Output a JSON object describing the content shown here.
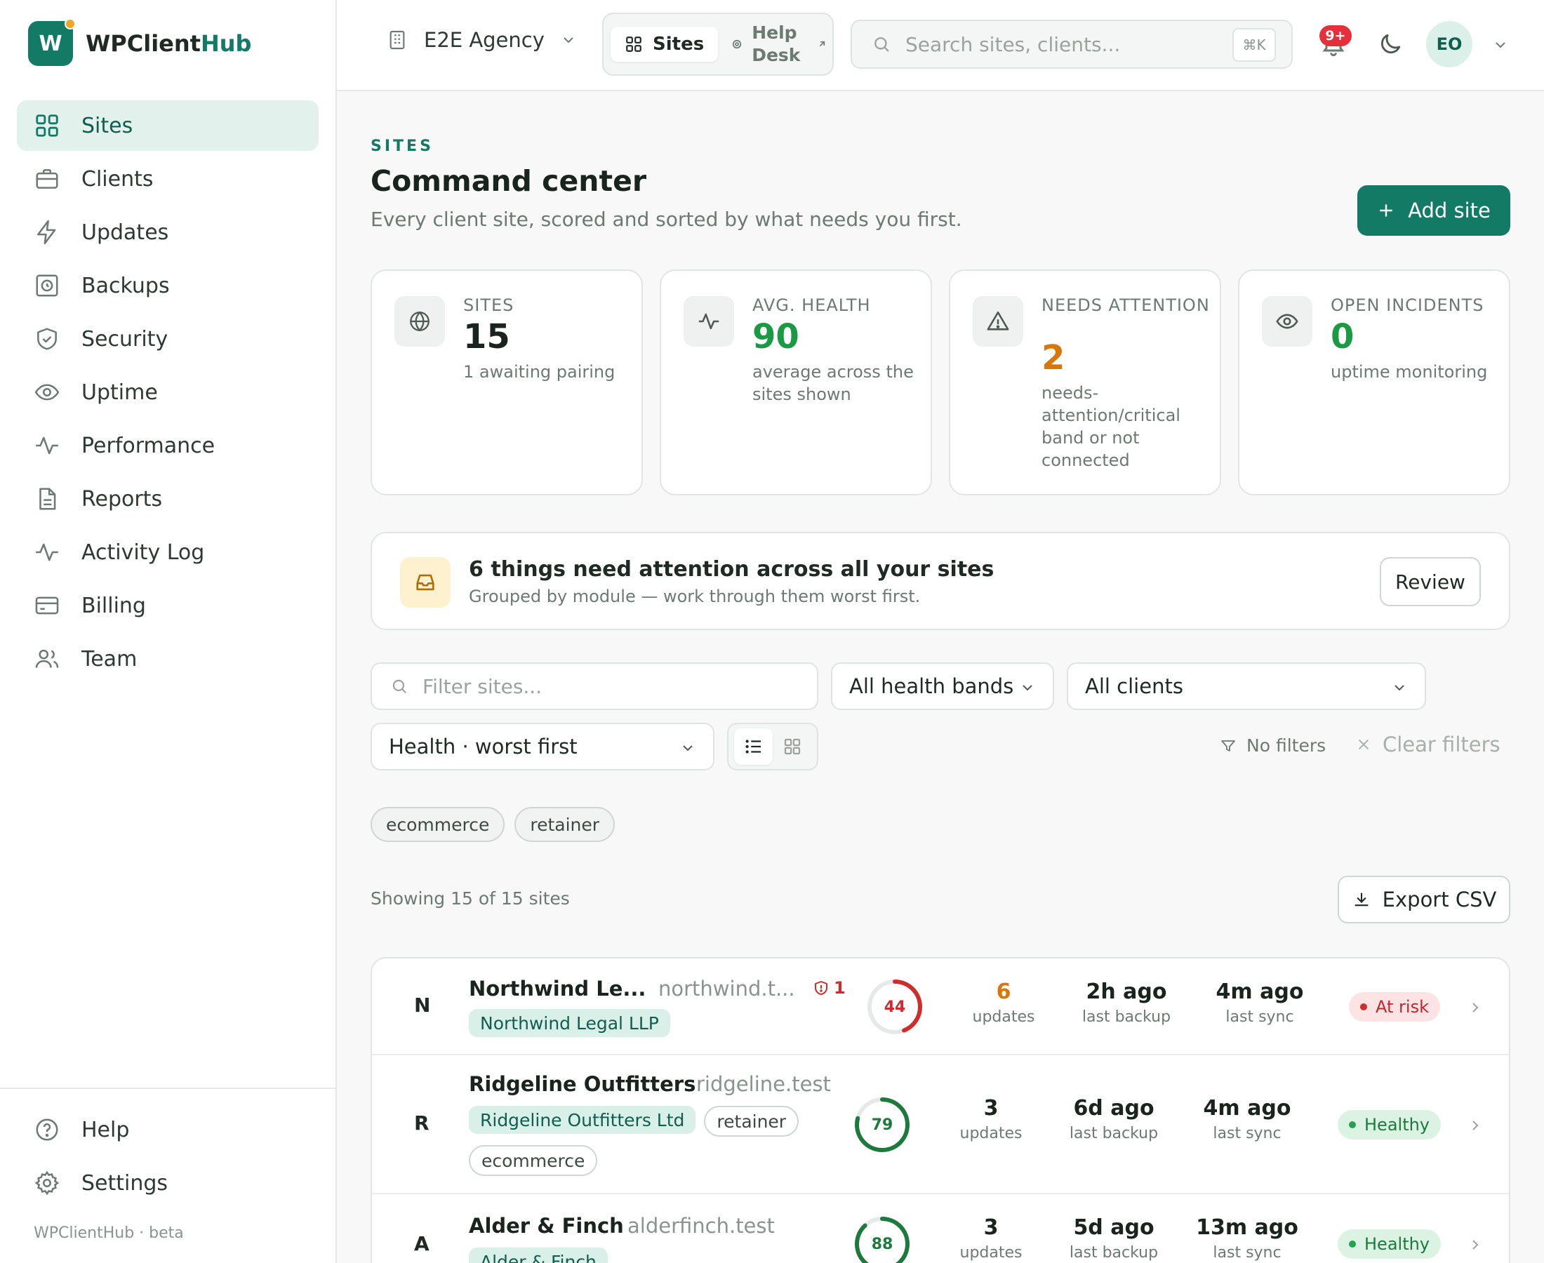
{
  "brand": {
    "name_main": "WPClient",
    "name_accent": "Hub",
    "logo_letter": "W"
  },
  "sidebar": {
    "items": [
      {
        "label": "Sites",
        "icon": "grid-icon",
        "active": true
      },
      {
        "label": "Clients",
        "icon": "briefcase-icon"
      },
      {
        "label": "Updates",
        "icon": "bolt-icon"
      },
      {
        "label": "Backups",
        "icon": "clock-box-icon"
      },
      {
        "label": "Security",
        "icon": "shield-check-icon"
      },
      {
        "label": "Uptime",
        "icon": "eye-icon"
      },
      {
        "label": "Performance",
        "icon": "pulse-icon"
      },
      {
        "label": "Reports",
        "icon": "document-icon"
      },
      {
        "label": "Activity Log",
        "icon": "pulse-icon"
      },
      {
        "label": "Billing",
        "icon": "card-icon"
      },
      {
        "label": "Team",
        "icon": "users-icon"
      }
    ],
    "bottom": [
      {
        "label": "Help",
        "icon": "help-circle-icon"
      },
      {
        "label": "Settings",
        "icon": "gear-icon"
      }
    ],
    "footer": "WPClientHub · beta"
  },
  "header": {
    "agency": "E2E Agency",
    "switcher": {
      "active": "Sites",
      "other": "Help Desk"
    },
    "search_placeholder": "Search sites, clients...",
    "search_shortcut": "⌘K",
    "notifications_badge": "9+",
    "avatar_initials": "EO"
  },
  "page": {
    "eyebrow": "SITES",
    "title": "Command center",
    "subtitle": "Every client site, scored and sorted by what needs you first.",
    "add_button": "Add site"
  },
  "stats": [
    {
      "label": "SITES",
      "value": "15",
      "note": "1 awaiting pairing",
      "icon": "globe-icon",
      "color": "#1a241f"
    },
    {
      "label": "AVG. HEALTH",
      "value": "90",
      "note": "average across the sites shown",
      "icon": "pulse-icon",
      "color": "#1b9a44"
    },
    {
      "label": "NEEDS ATTENTION",
      "value": "2",
      "note": "needs-attention/critical band or not connected",
      "icon": "warning-icon",
      "color": "#d97706"
    },
    {
      "label": "OPEN INCIDENTS",
      "value": "0",
      "note": "uptime monitoring",
      "icon": "eye-icon",
      "color": "#1b9a44"
    }
  ],
  "attention": {
    "title": "6 things need attention across all your sites",
    "subtitle": "Grouped by module — work through them worst first.",
    "button": "Review"
  },
  "filters": {
    "filter_placeholder": "Filter sites...",
    "health_band": "All health bands",
    "clients": "All clients",
    "sort": "Health · worst first",
    "no_filters": "No filters",
    "clear_filters": "Clear filters",
    "tags": [
      "ecommerce",
      "retainer"
    ]
  },
  "results": {
    "showing": "Showing 15 of 15 sites",
    "export": "Export CSV"
  },
  "sites": [
    {
      "initial": "N",
      "name": "Northwind Le...",
      "domain": "northwind.t...",
      "security_count": "1",
      "client": "Northwind Legal LLP",
      "tags": [],
      "score": "44",
      "score_fraction": 0.44,
      "score_color": "#d12c2c",
      "updates": "6",
      "updates_label": "updates",
      "updates_color": "#d97706",
      "backup": "2h ago",
      "backup_label": "last backup",
      "sync": "4m ago",
      "sync_label": "last sync",
      "status": "At risk",
      "status_kind": "risk"
    },
    {
      "initial": "R",
      "name": "Ridgeline Outfitters",
      "domain": "ridgeline.test",
      "security_count": "",
      "client": "Ridgeline Outfitters Ltd",
      "tags": [
        "retainer",
        "ecommerce"
      ],
      "score": "79",
      "score_fraction": 0.79,
      "score_color": "#1b7a3c",
      "updates": "3",
      "updates_label": "updates",
      "updates_color": "#1a241f",
      "backup": "6d ago",
      "backup_label": "last backup",
      "sync": "4m ago",
      "sync_label": "last sync",
      "status": "Healthy",
      "status_kind": "ok"
    },
    {
      "initial": "A",
      "name": "Alder & Finch",
      "domain": "alderfinch.test",
      "security_count": "",
      "client": "Alder & Finch",
      "tags": [],
      "score": "88",
      "score_fraction": 0.88,
      "score_color": "#1b7a3c",
      "updates": "3",
      "updates_label": "updates",
      "updates_color": "#1a241f",
      "backup": "5d ago",
      "backup_label": "last backup",
      "sync": "13m ago",
      "sync_label": "last sync",
      "status": "Healthy",
      "status_kind": "ok"
    }
  ]
}
